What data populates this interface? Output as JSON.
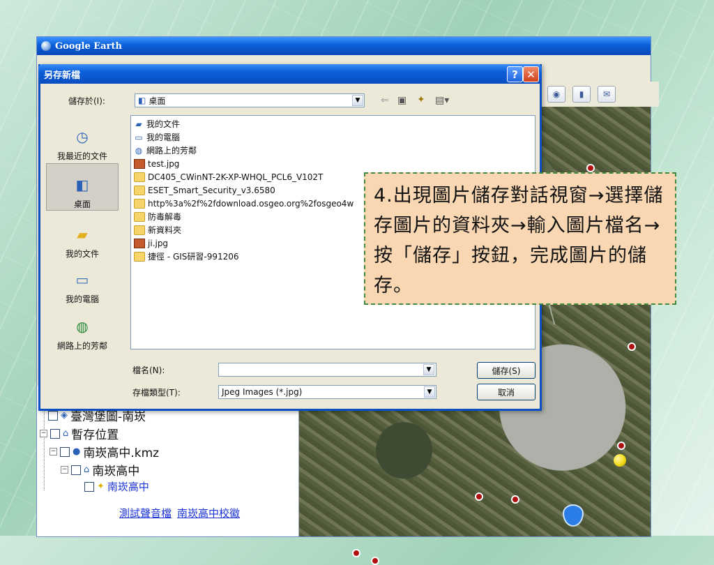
{
  "google_earth": {
    "title": "Google Earth",
    "sidebar_items": [
      {
        "label": "臺灣堡圖-南崁"
      },
      {
        "label": "暫存位置"
      },
      {
        "label": "南崁高中.kmz"
      },
      {
        "label": "南崁高中"
      },
      {
        "label": "南崁高中"
      }
    ],
    "links": [
      "測試聲音檔",
      "南崁高中校徽"
    ]
  },
  "dialog": {
    "title": "另存新檔",
    "save_in_label": "儲存於(I):",
    "save_in_value": "桌面",
    "places": [
      "我最近的文件",
      "桌面",
      "我的文件",
      "我的電腦",
      "網路上的芳鄰"
    ],
    "files": [
      {
        "name": "我的文件",
        "type": "system"
      },
      {
        "name": "我的電腦",
        "type": "system"
      },
      {
        "name": "網路上的芳鄰",
        "type": "system"
      },
      {
        "name": "test.jpg",
        "type": "image"
      },
      {
        "name": "DC405_CWinNT-2K-XP-WHQL_PCL6_V102T",
        "type": "folder"
      },
      {
        "name": "ESET_Smart_Security_v3.6580",
        "type": "folder"
      },
      {
        "name": "http%3a%2f%2fdownload.osgeo.org%2fosgeo4w",
        "type": "folder"
      },
      {
        "name": "防毒解毒",
        "type": "folder"
      },
      {
        "name": "新資料夾",
        "type": "folder"
      },
      {
        "name": "ji.jpg",
        "type": "image"
      },
      {
        "name": "捷徑 - GIS研習-991206",
        "type": "folder"
      }
    ],
    "filename_label": "檔名(N):",
    "filename_value": "",
    "filetype_label": "存檔類型(T):",
    "filetype_value": "Jpeg Images (*.jpg)",
    "save_button": "儲存(S)",
    "cancel_button": "取消",
    "help_button": "?",
    "close_button": "✕"
  },
  "callout": {
    "text": "4.出現圖片儲存對話視窗→選擇儲存圖片的資料夾→輸入圖片檔名→按「儲存」按鈕，完成圖片的儲存。"
  },
  "colors": {
    "titlebar": "#0a5fd8",
    "callout_bg": "#f9d7b3",
    "callout_border": "#3f8a3f",
    "link": "#1a33d6"
  }
}
